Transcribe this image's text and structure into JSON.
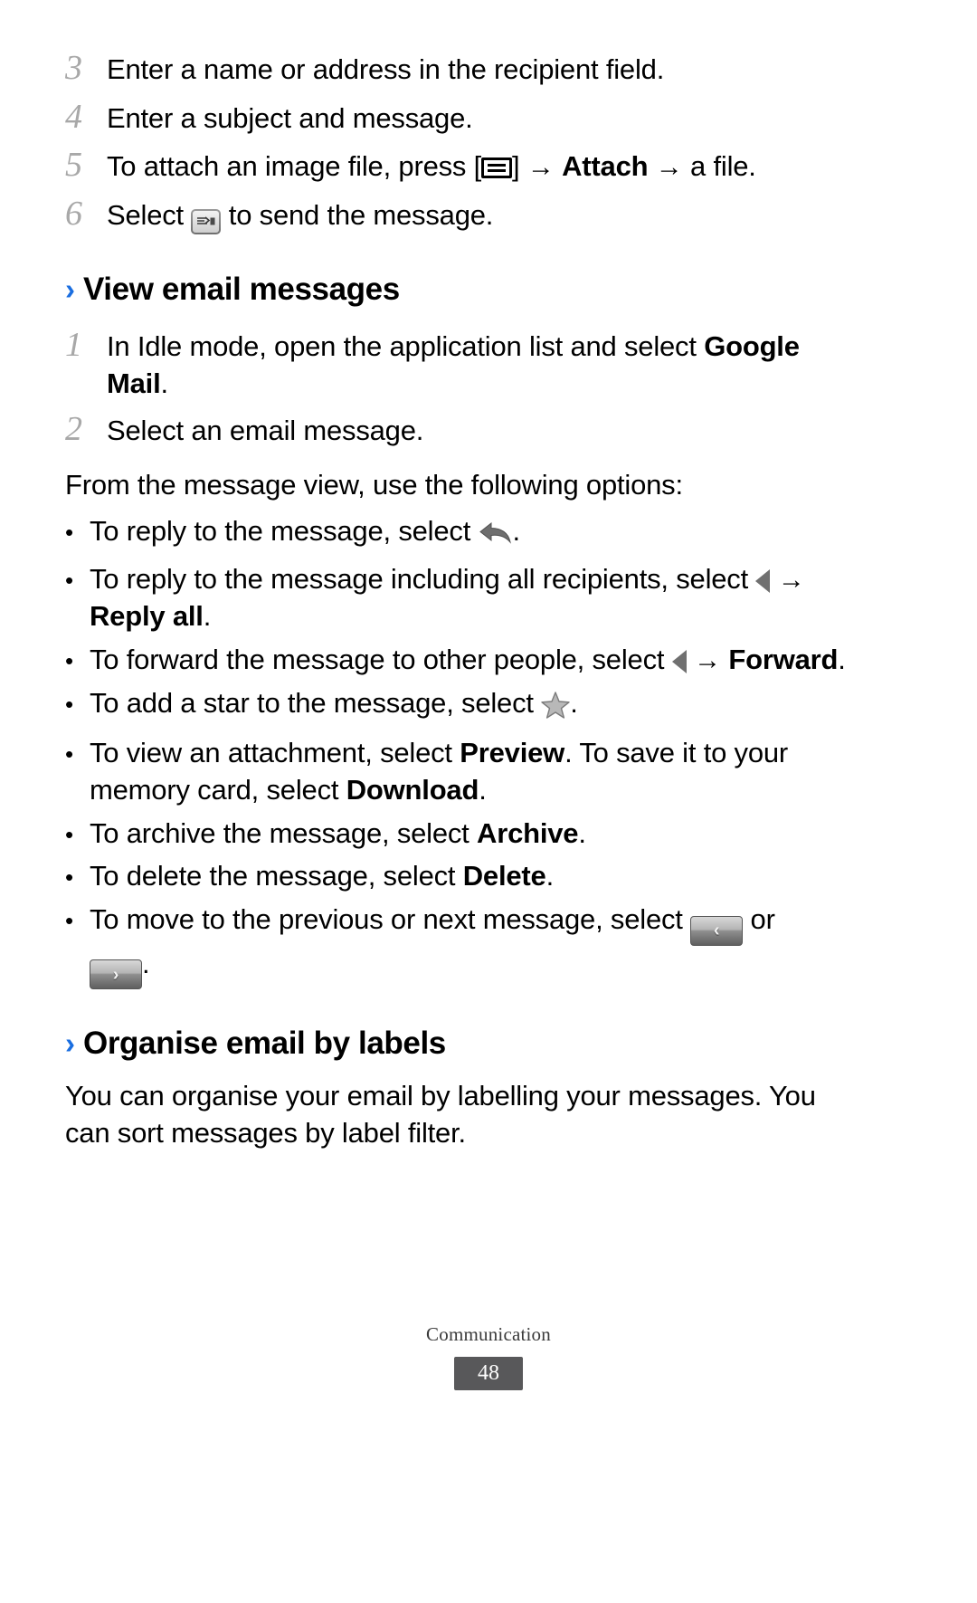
{
  "accent_color": "#1a6ee0",
  "steps_group_1": [
    {
      "num": "3",
      "text": "Enter a name or address in the recipient field."
    },
    {
      "num": "4",
      "text": "Enter a subject and message."
    },
    {
      "num": "5",
      "pre": "To attach an image file, press [",
      "icon": "menu-key-icon",
      "mid": "] ",
      "arrow1": "→",
      "bold1": "Attach",
      "arrow2": "→",
      "post": " a file."
    },
    {
      "num": "6",
      "pre": "Select ",
      "icon": "send-icon",
      "post": " to send the message."
    }
  ],
  "section_view_email": {
    "chevron": "›",
    "title": "View email messages",
    "steps": [
      {
        "num": "1",
        "pre": "In Idle mode, open the application list and select ",
        "bold": "Google Mail",
        "post": "."
      },
      {
        "num": "2",
        "pre": "Select an email message."
      }
    ],
    "intro": "From the message view, use the following options:",
    "bullets": [
      {
        "dot": "•",
        "pre": "To reply to the message, select ",
        "icon": "reply-arrow-icon",
        "post": "."
      },
      {
        "dot": "•",
        "pre": "To reply to the message including all recipients, select ",
        "icon": "triangle-left-icon",
        "arrow": "→",
        "bold": "Reply all",
        "post": "."
      },
      {
        "dot": "•",
        "pre": "To forward the message to other people, select ",
        "icon": "triangle-left-icon",
        "arrow": "→",
        "bold": "Forward",
        "post": "."
      },
      {
        "dot": "•",
        "pre": "To add a star to the message, select ",
        "icon": "star-icon",
        "post": "."
      },
      {
        "dot": "•",
        "pre": "To view an attachment, select ",
        "bold": "Preview",
        "mid": ". To save it to your memory card, select ",
        "bold2": "Download",
        "post": "."
      },
      {
        "dot": "•",
        "pre": "To archive the message, select ",
        "bold": "Archive",
        "post": "."
      },
      {
        "dot": "•",
        "pre": "To delete the message, select ",
        "bold": "Delete",
        "post": "."
      },
      {
        "dot": "•",
        "pre": "To move to the previous or next message, select ",
        "icon": "previous-message-button",
        "mid": " or ",
        "icon2": "next-message-button",
        "post": ".",
        "prev_glyph": "‹",
        "next_glyph": "›"
      }
    ]
  },
  "section_organise": {
    "chevron": "›",
    "title": "Organise email by labels",
    "body": "You can organise your email by labelling your messages. You can sort messages by label filter."
  },
  "footer": {
    "label": "Communication",
    "page_number": "48"
  }
}
